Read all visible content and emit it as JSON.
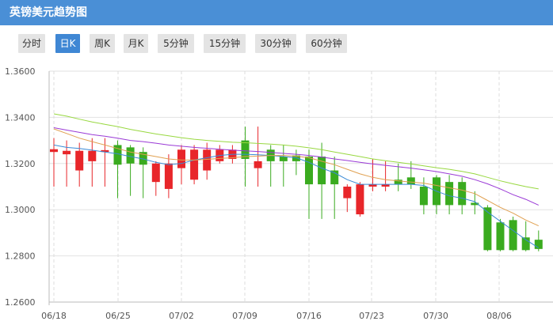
{
  "header": {
    "title": "英镑美元趋势图"
  },
  "tabs": [
    {
      "label": "分时",
      "active": false
    },
    {
      "label": "日K",
      "active": true
    },
    {
      "label": "周K",
      "active": false
    },
    {
      "label": "月K",
      "active": false
    },
    {
      "label": "5分钟",
      "active": false
    },
    {
      "label": "15分钟",
      "active": false
    },
    {
      "label": "30分钟",
      "active": false
    },
    {
      "label": "60分钟",
      "active": false
    }
  ],
  "colors": {
    "up": "#e8262a",
    "down": "#3aab1f",
    "ma_blue": "#3a8ad6",
    "ma_orange": "#e0a050",
    "ma_purple": "#9a3ad6",
    "ma_green": "#98d840"
  },
  "chart_data": {
    "type": "candlestick",
    "title": "",
    "ylim": [
      1.26,
      1.36
    ],
    "y_ticks": [
      "1.3600",
      "1.3400",
      "1.3200",
      "1.3000",
      "1.2800",
      "1.2600"
    ],
    "x_ticks": [
      "06/18",
      "06/25",
      "07/02",
      "07/09",
      "07/16",
      "07/23",
      "07/30",
      "08/06"
    ],
    "candles": [
      {
        "o": 1.325,
        "c": 1.3262,
        "h": 1.331,
        "l": 1.31
      },
      {
        "o": 1.324,
        "c": 1.3255,
        "h": 1.33,
        "l": 1.31
      },
      {
        "o": 1.317,
        "c": 1.3255,
        "h": 1.329,
        "l": 1.31
      },
      {
        "o": 1.321,
        "c": 1.3255,
        "h": 1.331,
        "l": 1.31
      },
      {
        "o": 1.325,
        "c": 1.3258,
        "h": 1.331,
        "l": 1.31
      },
      {
        "o": 1.328,
        "c": 1.3195,
        "h": 1.33,
        "l": 1.305
      },
      {
        "o": 1.327,
        "c": 1.32,
        "h": 1.328,
        "l": 1.306
      },
      {
        "o": 1.325,
        "c": 1.3195,
        "h": 1.327,
        "l": 1.305
      },
      {
        "o": 1.312,
        "c": 1.32,
        "h": 1.321,
        "l": 1.306
      },
      {
        "o": 1.309,
        "c": 1.32,
        "h": 1.324,
        "l": 1.305
      },
      {
        "o": 1.318,
        "c": 1.326,
        "h": 1.328,
        "l": 1.311
      },
      {
        "o": 1.313,
        "c": 1.326,
        "h": 1.328,
        "l": 1.311
      },
      {
        "o": 1.317,
        "c": 1.326,
        "h": 1.329,
        "l": 1.313
      },
      {
        "o": 1.321,
        "c": 1.326,
        "h": 1.328,
        "l": 1.32
      },
      {
        "o": 1.322,
        "c": 1.326,
        "h": 1.328,
        "l": 1.32
      },
      {
        "o": 1.33,
        "c": 1.322,
        "h": 1.336,
        "l": 1.31
      },
      {
        "o": 1.318,
        "c": 1.321,
        "h": 1.336,
        "l": 1.31
      },
      {
        "o": 1.326,
        "c": 1.321,
        "h": 1.328,
        "l": 1.31
      },
      {
        "o": 1.323,
        "c": 1.321,
        "h": 1.328,
        "l": 1.31
      },
      {
        "o": 1.3235,
        "c": 1.321,
        "h": 1.326,
        "l": 1.315
      },
      {
        "o": 1.323,
        "c": 1.311,
        "h": 1.326,
        "l": 1.296
      },
      {
        "o": 1.323,
        "c": 1.311,
        "h": 1.329,
        "l": 1.296
      },
      {
        "o": 1.317,
        "c": 1.311,
        "h": 1.323,
        "l": 1.296
      },
      {
        "o": 1.305,
        "c": 1.31,
        "h": 1.311,
        "l": 1.299
      },
      {
        "o": 1.298,
        "c": 1.311,
        "h": 1.312,
        "l": 1.297
      },
      {
        "o": 1.31,
        "c": 1.311,
        "h": 1.322,
        "l": 1.308
      },
      {
        "o": 1.31,
        "c": 1.311,
        "h": 1.321,
        "l": 1.308
      },
      {
        "o": 1.313,
        "c": 1.311,
        "h": 1.32,
        "l": 1.308
      },
      {
        "o": 1.314,
        "c": 1.311,
        "h": 1.321,
        "l": 1.309
      },
      {
        "o": 1.31,
        "c": 1.302,
        "h": 1.314,
        "l": 1.298
      },
      {
        "o": 1.314,
        "c": 1.302,
        "h": 1.315,
        "l": 1.298
      },
      {
        "o": 1.312,
        "c": 1.302,
        "h": 1.315,
        "l": 1.298
      },
      {
        "o": 1.312,
        "c": 1.302,
        "h": 1.314,
        "l": 1.298
      },
      {
        "o": 1.303,
        "c": 1.302,
        "h": 1.308,
        "l": 1.298
      },
      {
        "o": 1.301,
        "c": 1.2825,
        "h": 1.302,
        "l": 1.282
      },
      {
        "o": 1.2945,
        "c": 1.2825,
        "h": 1.296,
        "l": 1.282
      },
      {
        "o": 1.2955,
        "c": 1.2825,
        "h": 1.297,
        "l": 1.282
      },
      {
        "o": 1.288,
        "c": 1.2825,
        "h": 1.295,
        "l": 1.282
      },
      {
        "o": 1.287,
        "c": 1.283,
        "h": 1.291,
        "l": 1.282
      }
    ],
    "ma": [
      {
        "color_key": "ma_blue",
        "values": [
          1.328,
          1.327,
          1.3265,
          1.3258,
          1.325,
          1.3242,
          1.323,
          1.322,
          1.3205,
          1.3195,
          1.32,
          1.3215,
          1.3225,
          1.3235,
          1.324,
          1.324,
          1.3238,
          1.3235,
          1.323,
          1.3225,
          1.3205,
          1.318,
          1.316,
          1.313,
          1.311,
          1.311,
          1.311,
          1.311,
          1.311,
          1.3105,
          1.308,
          1.306,
          1.305,
          1.3035,
          1.299,
          1.295,
          1.291,
          1.287,
          1.2835
        ]
      },
      {
        "color_key": "ma_orange",
        "values": [
          1.335,
          1.333,
          1.331,
          1.3295,
          1.328,
          1.3265,
          1.325,
          1.324,
          1.323,
          1.322,
          1.3215,
          1.3215,
          1.3218,
          1.3222,
          1.3225,
          1.323,
          1.3232,
          1.3235,
          1.3235,
          1.3232,
          1.3225,
          1.321,
          1.3195,
          1.3175,
          1.3155,
          1.314,
          1.313,
          1.3125,
          1.312,
          1.3115,
          1.3105,
          1.3095,
          1.3085,
          1.307,
          1.304,
          1.301,
          1.2985,
          1.2955,
          1.293
        ]
      },
      {
        "color_key": "ma_purple",
        "values": [
          1.3355,
          1.3345,
          1.3335,
          1.3325,
          1.3318,
          1.331,
          1.33,
          1.3295,
          1.3288,
          1.328,
          1.3275,
          1.327,
          1.3266,
          1.3262,
          1.3258,
          1.3255,
          1.3252,
          1.3248,
          1.3244,
          1.324,
          1.3235,
          1.3228,
          1.322,
          1.3213,
          1.3205,
          1.3198,
          1.3192,
          1.3186,
          1.318,
          1.3173,
          1.3165,
          1.3155,
          1.3145,
          1.313,
          1.3112,
          1.309,
          1.3065,
          1.3045,
          1.302
        ]
      },
      {
        "color_key": "ma_green",
        "values": [
          1.3415,
          1.3405,
          1.3392,
          1.338,
          1.337,
          1.336,
          1.3348,
          1.3338,
          1.3328,
          1.332,
          1.3312,
          1.3305,
          1.33,
          1.3296,
          1.3292,
          1.329,
          1.3287,
          1.3284,
          1.328,
          1.3275,
          1.3268,
          1.326,
          1.325,
          1.324,
          1.323,
          1.322,
          1.3212,
          1.3205,
          1.3198,
          1.319,
          1.3182,
          1.3175,
          1.3166,
          1.3155,
          1.314,
          1.3125,
          1.3112,
          1.31,
          1.309
        ]
      }
    ]
  }
}
